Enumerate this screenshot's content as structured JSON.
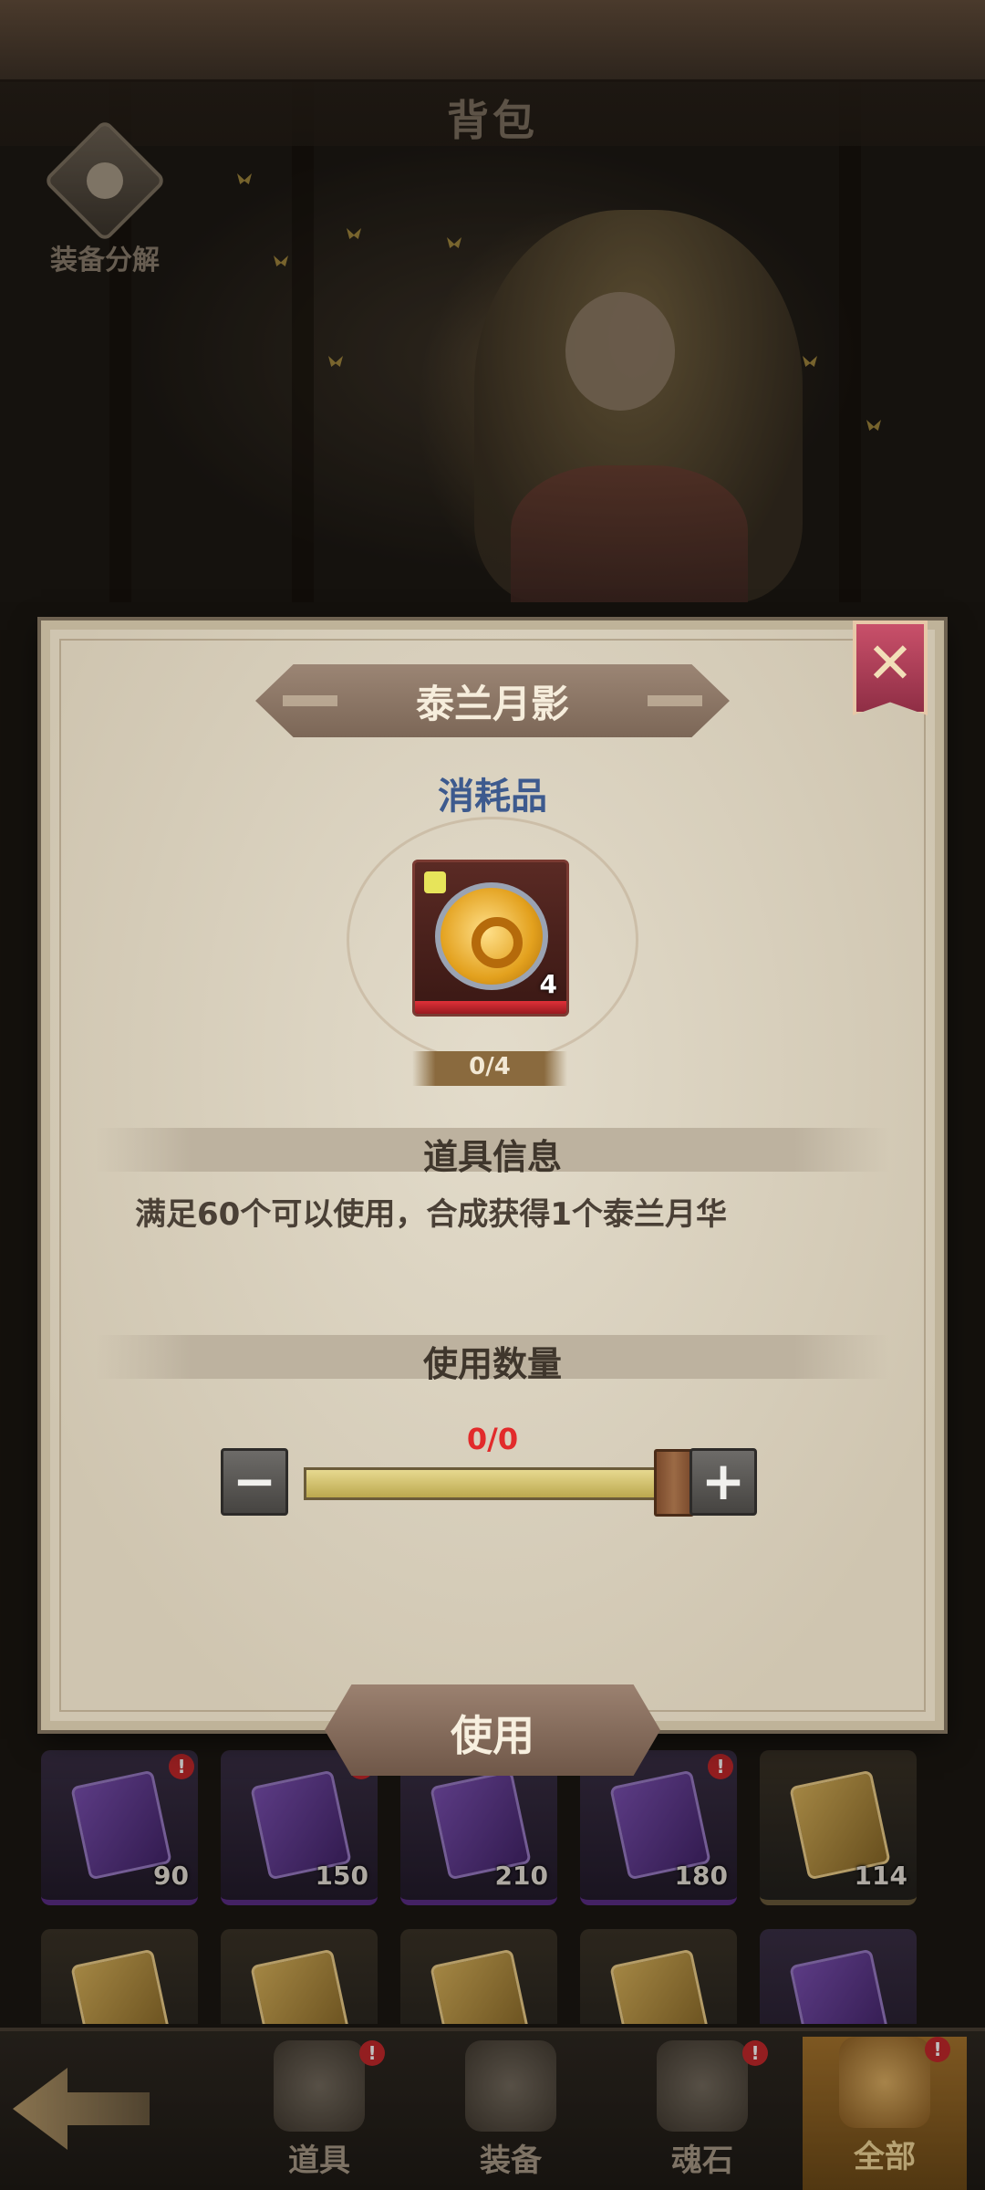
{
  "header": {
    "title": "背包"
  },
  "salvage": {
    "label": "装备分解",
    "icon": "salvage-icon"
  },
  "modal": {
    "title": "泰兰月影",
    "category": "消耗品",
    "item": {
      "icon": "moon-orb-icon",
      "quantity": "4",
      "progress": "0/4"
    },
    "info_heading": "道具信息",
    "description": "满足60个可以使用，合成获得1个泰兰月华",
    "quantity_heading": "使用数量",
    "quantity_value": "0/0",
    "slider_fill": 1.0,
    "minus_label": "−",
    "plus_label": "+",
    "use_button": "使用",
    "close_label": "✕"
  },
  "inventory": {
    "row1": [
      {
        "count": "90",
        "style": "purple",
        "alert": true
      },
      {
        "count": "150",
        "style": "purple",
        "alert": true
      },
      {
        "count": "210",
        "style": "purple",
        "alert": false
      },
      {
        "count": "180",
        "style": "purple",
        "alert": true
      },
      {
        "count": "114",
        "style": "gold",
        "alert": false
      }
    ],
    "row2": [
      {
        "style": "gold"
      },
      {
        "style": "gold"
      },
      {
        "style": "gold"
      },
      {
        "style": "gold"
      },
      {
        "style": "purple"
      }
    ],
    "alert_mark": "!"
  },
  "bottom_nav": {
    "tabs": [
      {
        "label": "道具",
        "icon": "scroll-icon",
        "alert": true,
        "active": false
      },
      {
        "label": "装备",
        "icon": "armor-icon",
        "alert": false,
        "active": false
      },
      {
        "label": "魂石",
        "icon": "soulstone-icon",
        "alert": true,
        "active": false
      },
      {
        "label": "全部",
        "icon": "all-items-icon",
        "alert": true,
        "active": true
      }
    ]
  },
  "colors": {
    "accent_blue": "#3d5a8e",
    "alert_red": "#c4282b",
    "quantity_red": "#e22b2b"
  }
}
